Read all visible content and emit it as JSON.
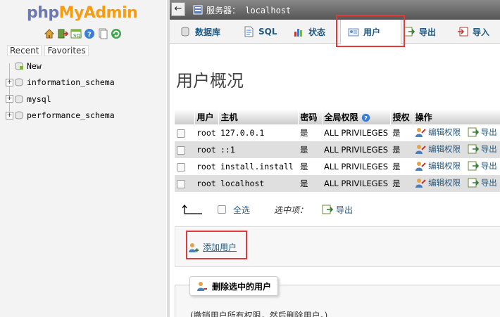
{
  "logo": {
    "php": "php",
    "admin": "MyAdmin"
  },
  "nav": {
    "icons": [
      "home-icon",
      "exit-icon",
      "query-window-icon",
      "docs-icon",
      "copy-icon",
      "reload-icon"
    ],
    "recent_label": "Recent",
    "favorites_label": "Favorites",
    "tree": [
      {
        "name": "New",
        "expandable": false
      },
      {
        "name": "information_schema",
        "expandable": true
      },
      {
        "name": "mysql",
        "expandable": true
      },
      {
        "name": "performance_schema",
        "expandable": true
      }
    ]
  },
  "topbar": {
    "server_label": "服务器： localhost"
  },
  "tabs": [
    {
      "label": "数据库",
      "icon": "database-icon"
    },
    {
      "label": "SQL",
      "icon": "sql-icon"
    },
    {
      "label": "状态",
      "icon": "status-icon"
    },
    {
      "label": "用户",
      "icon": "users-icon",
      "active": true
    },
    {
      "label": "导出",
      "icon": "export-icon"
    },
    {
      "label": "导入",
      "icon": "import-icon"
    }
  ],
  "page_title": "用户概况",
  "table": {
    "headers": {
      "user": "用户",
      "host": "主机",
      "password": "密码",
      "global_privs": "全局权限",
      "grant": "授权",
      "action": "操作"
    },
    "rows": [
      {
        "user": "root",
        "host": "127.0.0.1",
        "password": "是",
        "privileges": "ALL PRIVILEGES",
        "grant": "是",
        "edit": "编辑权限",
        "export": "导出"
      },
      {
        "user": "root",
        "host": "::1",
        "password": "是",
        "privileges": "ALL PRIVILEGES",
        "grant": "是",
        "edit": "编辑权限",
        "export": "导出"
      },
      {
        "user": "root",
        "host": "install.install",
        "password": "是",
        "privileges": "ALL PRIVILEGES",
        "grant": "是",
        "edit": "编辑权限",
        "export": "导出"
      },
      {
        "user": "root",
        "host": "localhost",
        "password": "是",
        "privileges": "ALL PRIVILEGES",
        "grant": "是",
        "edit": "编辑权限",
        "export": "导出"
      }
    ]
  },
  "with_selected": {
    "select_all": "全选",
    "label": "选中项：",
    "export": "导出"
  },
  "add_user": {
    "label": "添加用户"
  },
  "delete_users": {
    "legend": "删除选中的用户",
    "note": "(撤销用户所有权限，然后删除用户。)"
  },
  "colors": {
    "link": "#235a81",
    "highlight": "#e23a3a",
    "logo_php": "#6c78af",
    "logo_admin": "#f89c0e"
  }
}
